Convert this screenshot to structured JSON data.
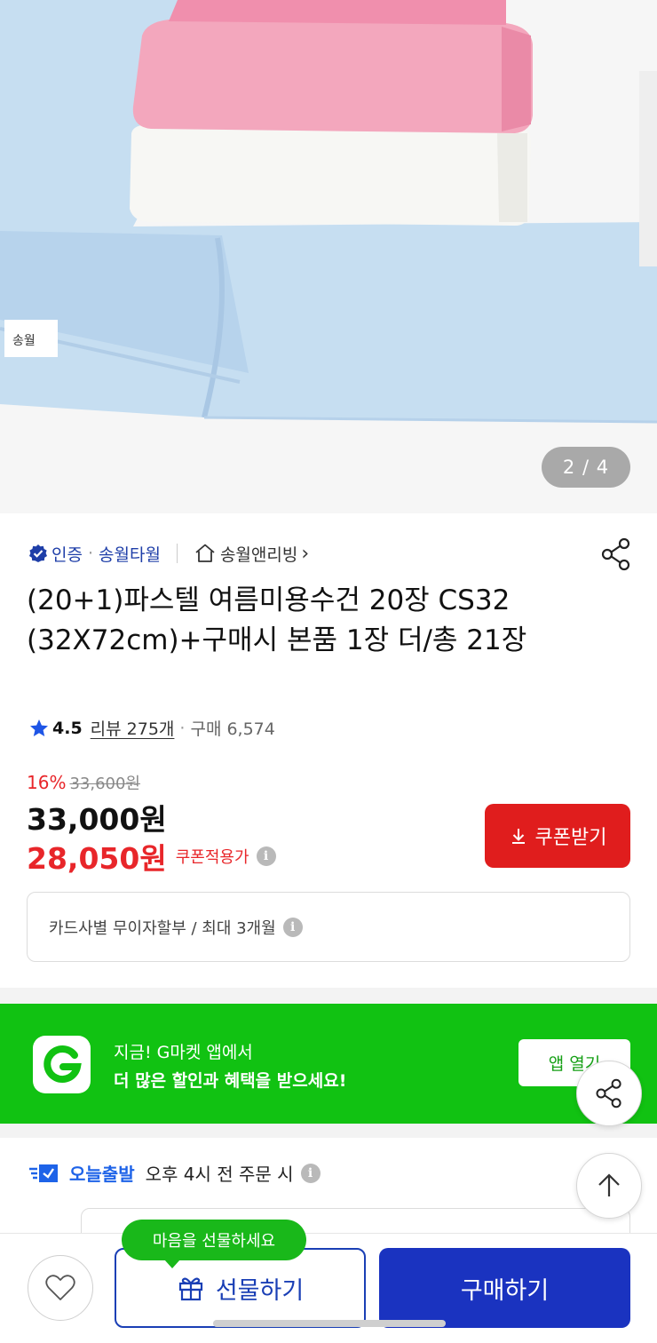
{
  "gallery": {
    "image_alt": "pastel towels",
    "counter": "2 / 4",
    "towel_colors": {
      "pink": "#f3a7bd",
      "white": "#f7f7f4",
      "blue": "#c6def1"
    }
  },
  "seller": {
    "certified_label": "인증",
    "separator": "·",
    "seller_name": "송월타월",
    "store_name": "송월앤리빙",
    "store_arrow": "›"
  },
  "product": {
    "title": "(20+1)파스텔 여름미용수건 20장 CS32 (32X72cm)+구매시 본품 1장 더/총 21장",
    "rating": "4.5",
    "review_label": "리뷰 275개",
    "purchase_label": "구매 6,574",
    "rating_separator": "·"
  },
  "price": {
    "discount_rate": "16%",
    "original_price": "33,600원",
    "sale_price": "33,000원",
    "coupon_price": "28,050원",
    "coupon_applied_label": "쿠폰적용가",
    "coupon_button": "쿠폰받기",
    "installment": "카드사별 무이자할부 / 최대 3개월"
  },
  "app_banner": {
    "line1": "지금! G마켓 앱에서",
    "line2": "더 많은 할인과 혜택을 받으세요!",
    "open_button": "앱 열기"
  },
  "delivery": {
    "label": "오늘출발",
    "text": "오후 4시 전 주문 시"
  },
  "bottom_bar": {
    "gift_tooltip": "마음을 선물하세요",
    "gift_button": "선물하기",
    "buy_button": "구매하기"
  },
  "colors": {
    "accent_red": "#e01d1d",
    "brand_blue": "#1a33c0",
    "banner_green": "#11c212"
  }
}
